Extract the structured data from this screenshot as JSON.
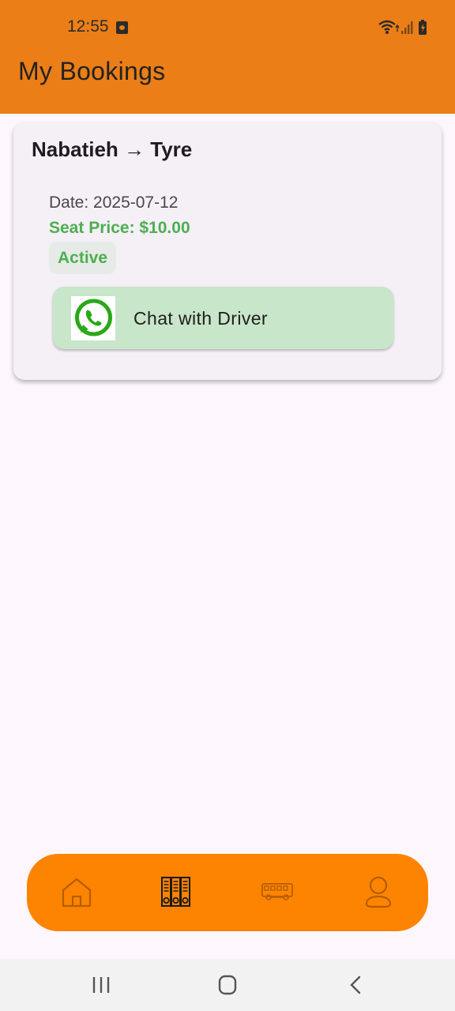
{
  "status_bar": {
    "time": "12:55"
  },
  "header": {
    "title": "My Bookings"
  },
  "booking": {
    "route": "Nabatieh → Tyre",
    "date": "Date: 2025-07-12",
    "price": "Seat Price: $10.00",
    "status": "Active",
    "chat_button": "Chat with Driver"
  },
  "bottom_nav": {
    "items": [
      {
        "icon": "home-icon",
        "active": false
      },
      {
        "icon": "bookings-icon",
        "active": true
      },
      {
        "icon": "bus-icon",
        "active": false
      },
      {
        "icon": "profile-icon",
        "active": false
      }
    ]
  },
  "colors": {
    "header": "#eb7e16",
    "nav_bar": "#fd8400",
    "accent_green": "#4caf50",
    "chat_button_bg": "#c8e6c9"
  }
}
